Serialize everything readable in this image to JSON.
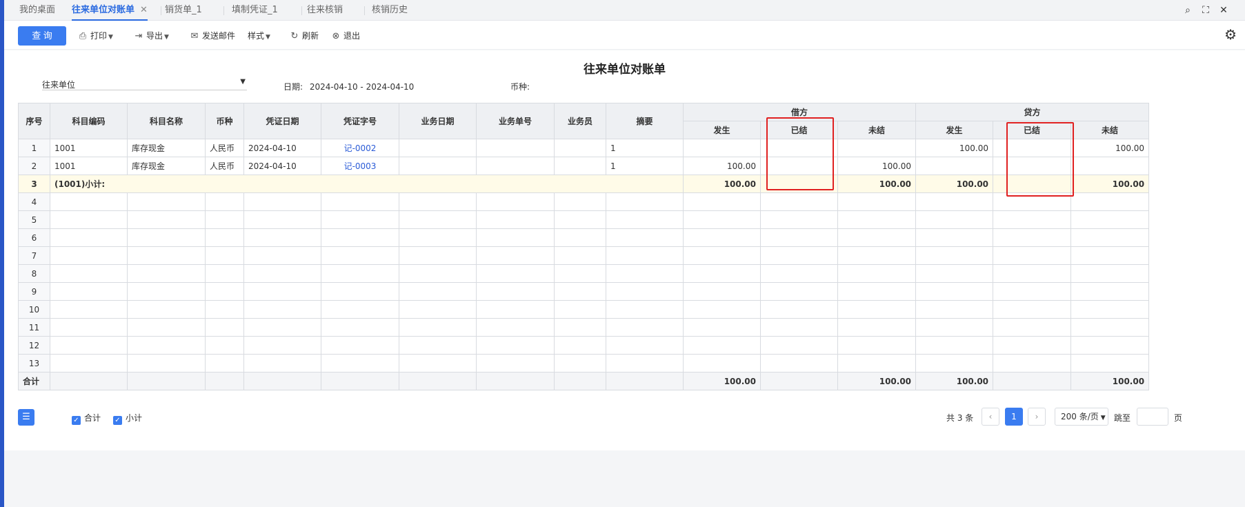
{
  "tabs": [
    {
      "label": "我的桌面",
      "active": false
    },
    {
      "label": "往来单位对账单",
      "active": true
    },
    {
      "label": "销货单_1",
      "active": false
    },
    {
      "label": "填制凭证_1",
      "active": false
    },
    {
      "label": "往来核销",
      "active": false
    },
    {
      "label": "核销历史",
      "active": false
    }
  ],
  "tab_close": "✕",
  "window_controls": {
    "search": "⌕",
    "maximize": "⛶",
    "close": "✕"
  },
  "toolbar": {
    "query": "查 询",
    "print": "打印",
    "export": "导出",
    "send_mail": "发送邮件",
    "style": "样式",
    "refresh": "刷新",
    "exit": "退出"
  },
  "report": {
    "title": "往来单位对账单",
    "partner_select": "往来单位",
    "date_label": "日期:",
    "date_value": "2024-04-10 - 2024-04-10",
    "currency_label": "币种:"
  },
  "table": {
    "headers": {
      "seq": "序号",
      "account_code": "科目编码",
      "account_name": "科目名称",
      "currency": "币种",
      "voucher_date": "凭证日期",
      "voucher_no": "凭证字号",
      "biz_date": "业务日期",
      "biz_no": "业务单号",
      "salesman": "业务员",
      "summary": "摘要",
      "debit": "借方",
      "credit": "贷方",
      "occurred": "发生",
      "settled": "已结",
      "unsettled": "未结"
    },
    "rows": [
      {
        "seq": "1",
        "code": "1001",
        "name": "库存现金",
        "currency": "人民币",
        "vdate": "2024-04-10",
        "vno": "记-0002",
        "bdate": "",
        "bno": "",
        "salesman": "",
        "summary": "1",
        "d_occ": "",
        "d_set": "",
        "d_unset": "",
        "c_occ": "100.00",
        "c_set": "",
        "c_unset": "100.00"
      },
      {
        "seq": "2",
        "code": "1001",
        "name": "库存现金",
        "currency": "人民币",
        "vdate": "2024-04-10",
        "vno": "记-0003",
        "bdate": "",
        "bno": "",
        "salesman": "",
        "summary": "1",
        "d_occ": "100.00",
        "d_set": "",
        "d_unset": "100.00",
        "c_occ": "",
        "c_set": "",
        "c_unset": ""
      }
    ],
    "subtotal": {
      "seq": "3",
      "label": "(1001)小计:",
      "d_occ": "100.00",
      "d_unset": "100.00",
      "c_occ": "100.00",
      "c_unset": "100.00"
    },
    "empty_seq": [
      "4",
      "5",
      "6",
      "7",
      "8",
      "9",
      "10",
      "11",
      "12",
      "13"
    ],
    "total": {
      "label": "合计",
      "d_occ": "100.00",
      "d_unset": "100.00",
      "c_occ": "100.00",
      "c_unset": "100.00"
    }
  },
  "footer": {
    "list_icon": "☰",
    "check_total": "合计",
    "check_subtotal": "小计",
    "count": "共 3 条",
    "prev": "‹",
    "page": "1",
    "next": "›",
    "page_size": "200 条/页",
    "jump": "跳至",
    "page_unit": "页"
  }
}
